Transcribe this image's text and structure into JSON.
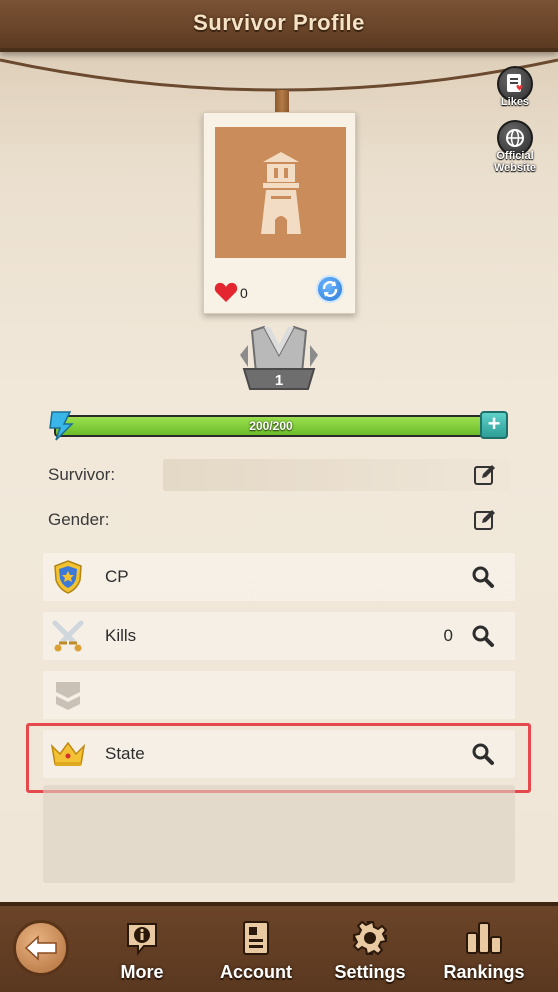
{
  "header": {
    "title": "Survivor Profile"
  },
  "side_buttons": [
    {
      "label": "Likes",
      "icon": "likes-icon"
    },
    {
      "label": "Official Website",
      "icon": "globe-icon"
    }
  ],
  "profile_card": {
    "likes_count": "0"
  },
  "rank": {
    "level": "1"
  },
  "stamina": {
    "text": "200/200",
    "fill": 1.0
  },
  "fields": {
    "survivor_label": "Survivor:",
    "gender_label": "Gender:"
  },
  "stats": [
    {
      "label": "CP",
      "value": "",
      "icon": "shield-icon"
    },
    {
      "label": "Kills",
      "value": "0",
      "icon": "crossed-swords-icon"
    },
    {
      "label": "",
      "value": "",
      "icon": "chevron-rank-icon"
    },
    {
      "label": "State",
      "value": "",
      "icon": "crown-icon"
    }
  ],
  "bottom_nav": [
    {
      "label": "More",
      "icon": "info-icon"
    },
    {
      "label": "Account",
      "icon": "account-card-icon"
    },
    {
      "label": "Settings",
      "icon": "gear-icon"
    },
    {
      "label": "Rankings",
      "icon": "bar-chart-icon"
    }
  ],
  "colors": {
    "header": "#6a4529",
    "highlight": "#e5484d",
    "bar_fill": "#7cc936",
    "photo_bg": "#c98c5a"
  }
}
